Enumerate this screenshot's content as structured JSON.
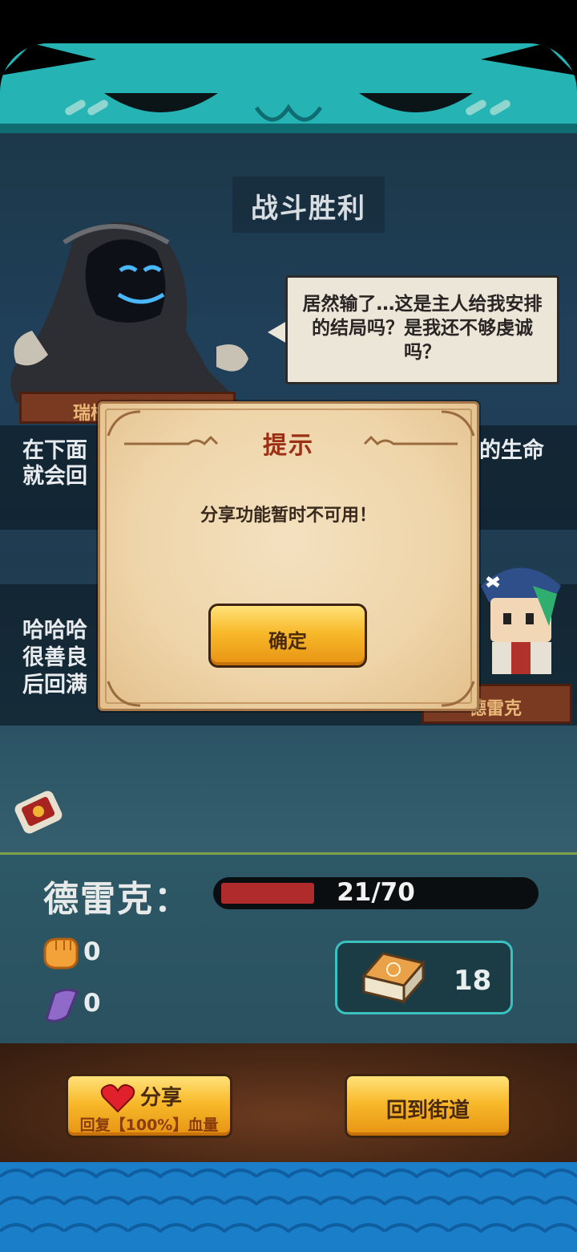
{
  "scene": {
    "title": "战斗胜利",
    "speech_bubble": "居然输了…这是主人给我安排的结局吗？是我还不够虔诚吗？",
    "enemy_name_partial": "瑞柏",
    "message1_left_line1": "在下面",
    "message1_left_line2": "就会回",
    "message1_right": "的生命",
    "message2_line1": "哈哈哈",
    "message2_line2": "很善良",
    "message2_line3": "后回满",
    "hero_name_partial": "德雷克"
  },
  "status": {
    "player_name": "德雷克：",
    "hp_text": "21/70",
    "hp_current": 21,
    "hp_max": 70,
    "attack_value": "0",
    "defense_value": "0",
    "deck_count": "18"
  },
  "actions": {
    "share_label": "分享",
    "share_sub": "回复【100%】血量",
    "back_label": "回到街道"
  },
  "dialog": {
    "title": "提示",
    "message": "分享功能暂时不可用！",
    "ok_label": "确定"
  },
  "colors": {
    "monster_teal": "#25b3b3",
    "hp_red": "#b02b2b",
    "gold_button": "#f8b92a",
    "dialog_title": "#9b3014"
  },
  "icons": {
    "attack": "fist-icon",
    "defense": "shield-icon",
    "deck": "card-deck-icon",
    "share": "heart-icon",
    "item": "scroll-item-icon"
  }
}
